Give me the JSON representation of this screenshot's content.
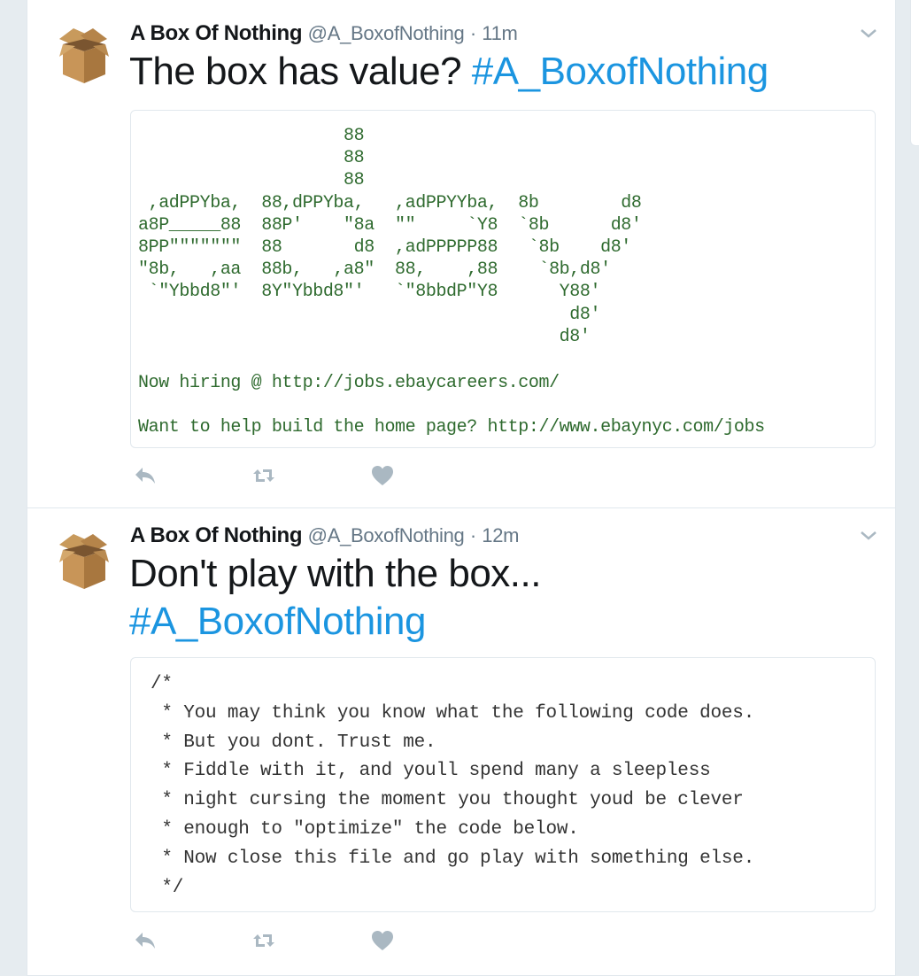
{
  "tweets": [
    {
      "name": "A Box Of Nothing",
      "handle": "@A_BoxofNothing",
      "separator": "·",
      "time": "11m",
      "text": "The box has value?",
      "hashtag": "#A_BoxofNothing",
      "card": {
        "ascii": "                    88\n                    88\n                    88\n ,adPPYba,  88,dPPYba,   ,adPPYYba,  8b        d8\na8P_____88  88P'    \"8a  \"\"     `Y8  `8b      d8'\n8PP\"\"\"\"\"\"\"  88       d8  ,adPPPPP88   `8b    d8'\n\"8b,   ,aa  88b,   ,a8\"  88,    ,88    `8b,d8'\n `\"Ybbd8\"'  8Y\"Ybbd8\"'   `\"8bbdP\"Y8      Y88'\n                                          d8'\n                                         d8'",
        "hiring": "Now hiring @ http://jobs.ebaycareers.com/",
        "help": "Want to help build the home page? http://www.ebaynyc.com/jobs"
      }
    },
    {
      "name": "A Box Of Nothing",
      "handle": "@A_BoxofNothing",
      "separator": "·",
      "time": "12m",
      "text": "Don't play with the box...",
      "hashtag": "#A_BoxofNothing",
      "card": {
        "code": "/*\n * You may think you know what the following code does.\n * But you dont. Trust me.\n * Fiddle with it, and youll spend many a sleepless\n * night cursing the moment you thought youd be clever\n * enough to \"optimize\" the code below.\n * Now close this file and go play with something else.\n */"
      }
    }
  ],
  "icons": {
    "avatar": "cardboard-box-icon",
    "caret": "chevron-down-icon",
    "reply": "reply-icon",
    "retweet": "retweet-icon",
    "like": "heart-icon"
  },
  "colors": {
    "background": "#e6ecf0",
    "hashtag": "#1b95e0",
    "ascii_green": "#2e6a2e",
    "icon_gray": "#aab8c2",
    "meta_gray": "#657786"
  }
}
